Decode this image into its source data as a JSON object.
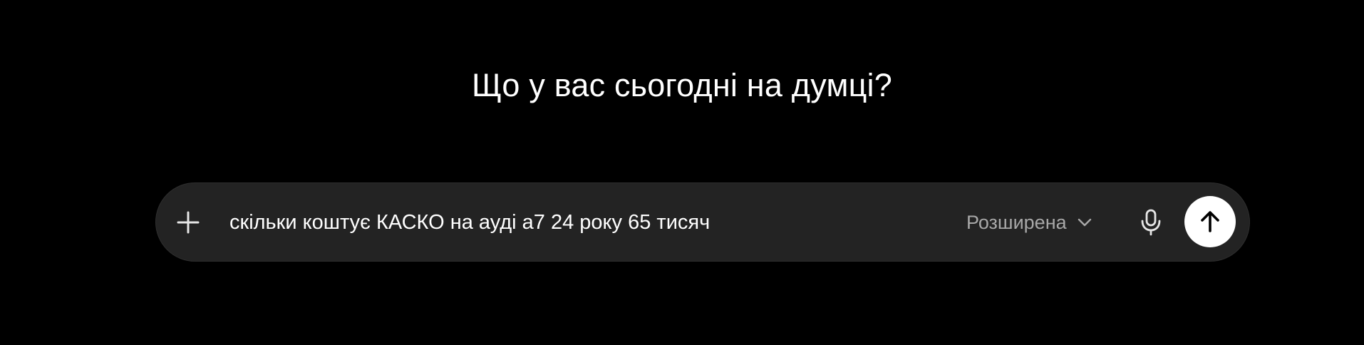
{
  "heading": "Що у вас сьогодні на думці?",
  "composer": {
    "input_value": "скільки коштує КАСКО на ауді а7 24 року 65 тисяч",
    "mode_label": "Розширена",
    "icons": {
      "add": "plus-icon",
      "mode_chevron": "chevron-down-icon",
      "voice": "microphone-icon",
      "send": "arrow-up-icon"
    }
  },
  "colors": {
    "background": "#000000",
    "composer_background": "#232323",
    "send_button": "#ffffff",
    "muted_text": "#a8a8a8"
  }
}
